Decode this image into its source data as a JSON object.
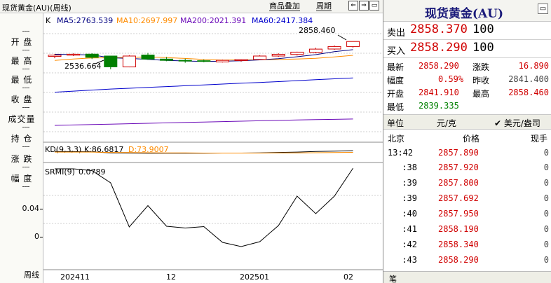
{
  "topbar": {
    "title": "现货黄金(AU)(周线)",
    "overlay_btn": "商品叠加",
    "period_btn": "周期"
  },
  "left_labels": [
    "开 盘",
    "最 高",
    "最 低",
    "收 盘",
    "成交量",
    "持 仓",
    "涨 跌",
    "幅 度"
  ],
  "left_axis": {
    "ticks": [
      "0.04",
      "0"
    ],
    "period_caption": "周线"
  },
  "indicators": {
    "k_prefix": "K",
    "ma": [
      {
        "label": "MA5:2763.539",
        "color": "#000080"
      },
      {
        "label": "MA10:2697.997",
        "color": "#ff8c00"
      },
      {
        "label": "MA200:2021.391",
        "color": "#6b0ab8"
      },
      {
        "label": "MA60:2417.384",
        "color": "#0000cc"
      }
    ],
    "kd": {
      "name": "KD(9,3,3)",
      "k": "K:86.6817",
      "d": "D:73.9007"
    },
    "srmi": {
      "name": "SRMI(9)",
      "value": "0.0789"
    }
  },
  "annotations": {
    "high": "2858.460",
    "low": "2536.664"
  },
  "x_axis_labels": [
    "202411",
    "12",
    "202501",
    "02"
  ],
  "colors": {
    "up": "#d00000",
    "down": "#008000",
    "ma5": "#000080",
    "ma10": "#ff8c00",
    "ma60": "#0000cc",
    "ma200": "#6b0ab8"
  },
  "quote": {
    "title": "现货黄金(AU)",
    "sell_label": "卖出",
    "sell_price": "2858.370",
    "sell_vol": "100",
    "buy_label": "买入",
    "buy_price": "2858.290",
    "buy_vol": "100",
    "stats": [
      {
        "label": "最新",
        "value": "2858.290",
        "color": "#d00000"
      },
      {
        "label": "涨跌",
        "value": "16.890",
        "color": "#d00000"
      },
      {
        "label": "幅度",
        "value": "0.59%",
        "color": "#d00000"
      },
      {
        "label": "昨收",
        "value": "2841.400",
        "color": "#000000"
      },
      {
        "label": "开盘",
        "value": "2841.910",
        "color": "#d00000"
      },
      {
        "label": "最高",
        "value": "2858.460",
        "color": "#d00000"
      },
      {
        "label": "最低",
        "value": "2839.335",
        "color": "#008000"
      }
    ],
    "unit_label": "单位",
    "unit_value": "元/克",
    "checkbox_label": "美元/盎司",
    "checkbox_checked": true,
    "tick_headers": [
      "北京",
      "价格",
      "现手"
    ],
    "ticks": [
      {
        "time": "13:42",
        "price": "2857.890",
        "vol": "0"
      },
      {
        "time": ":38",
        "price": "2857.920",
        "vol": "0"
      },
      {
        "time": ":39",
        "price": "2857.800",
        "vol": "0"
      },
      {
        "time": ":39",
        "price": "2857.692",
        "vol": "0"
      },
      {
        "time": ":40",
        "price": "2857.950",
        "vol": "0"
      },
      {
        "time": ":41",
        "price": "2858.190",
        "vol": "0"
      },
      {
        "time": ":42",
        "price": "2858.340",
        "vol": "0"
      },
      {
        "time": ":43",
        "price": "2858.290",
        "vol": "0"
      }
    ],
    "bottom_tab": "笔"
  },
  "chart_data": [
    {
      "type": "candlestick",
      "title": "",
      "x_labels": [
        "202411",
        "12",
        "202501",
        "02"
      ],
      "candles": [
        {
          "open": 2685,
          "high": 2712,
          "low": 2665,
          "close": 2700,
          "dir": "up"
        },
        {
          "open": 2700,
          "high": 2721,
          "low": 2690,
          "close": 2711,
          "dir": "up"
        },
        {
          "open": 2712,
          "high": 2722,
          "low": 2655,
          "close": 2675,
          "dir": "down"
        },
        {
          "open": 2690,
          "high": 2670,
          "low": 2536.664,
          "close": 2565,
          "dir": "down"
        },
        {
          "open": 2564,
          "high": 2700,
          "low": 2560,
          "close": 2690,
          "dir": "up"
        },
        {
          "open": 2702,
          "high": 2725,
          "low": 2645,
          "close": 2655,
          "dir": "down"
        },
        {
          "open": 2655,
          "high": 2680,
          "low": 2630,
          "close": 2640,
          "dir": "down"
        },
        {
          "open": 2640,
          "high": 2660,
          "low": 2612,
          "close": 2636,
          "dir": "down"
        },
        {
          "open": 2636,
          "high": 2650,
          "low": 2618,
          "close": 2628,
          "dir": "down"
        },
        {
          "open": 2622,
          "high": 2648,
          "low": 2615,
          "close": 2640,
          "dir": "up"
        },
        {
          "open": 2638,
          "high": 2654,
          "low": 2625,
          "close": 2650,
          "dir": "up"
        },
        {
          "open": 2650,
          "high": 2700,
          "low": 2642,
          "close": 2690,
          "dir": "up"
        },
        {
          "open": 2690,
          "high": 2722,
          "low": 2680,
          "close": 2710,
          "dir": "up"
        },
        {
          "open": 2708,
          "high": 2740,
          "low": 2696,
          "close": 2735,
          "dir": "up"
        },
        {
          "open": 2733,
          "high": 2786,
          "low": 2722,
          "close": 2770,
          "dir": "up"
        },
        {
          "open": 2771,
          "high": 2812,
          "low": 2760,
          "close": 2800,
          "dir": "up"
        },
        {
          "open": 2800,
          "high": 2858.46,
          "low": 2785,
          "close": 2858.29,
          "dir": "up"
        }
      ],
      "ma5": [
        2710,
        2707,
        2703,
        2670,
        2662,
        2652,
        2640,
        2632,
        2628,
        2630,
        2636,
        2645,
        2660,
        2682,
        2706,
        2740,
        2763.539
      ],
      "ma10": [
        2640,
        2656,
        2668,
        2670,
        2676,
        2680,
        2672,
        2662,
        2650,
        2644,
        2645,
        2646,
        2650,
        2655,
        2664,
        2680,
        2697.997
      ],
      "ma60": [
        2280,
        2290,
        2300,
        2310,
        2318,
        2326,
        2334,
        2342,
        2350,
        2358,
        2366,
        2374,
        2382,
        2391,
        2400,
        2409,
        2417.384
      ],
      "ma200": [
        1960,
        1964,
        1968,
        1972,
        1976,
        1980,
        1984,
        1988,
        1992,
        1996,
        2000,
        2004,
        2008,
        2012,
        2015,
        2018,
        2021.391
      ],
      "ylim": [
        1950,
        2880
      ]
    },
    {
      "type": "line",
      "name": "KD(9,3,3)",
      "series": [
        {
          "name": "K",
          "values": [
            80,
            79,
            78,
            70,
            68,
            67,
            67,
            67,
            67,
            68,
            68,
            70,
            73,
            76,
            80,
            83,
            86.6817
          ]
        },
        {
          "name": "D",
          "values": [
            76,
            76,
            76,
            73,
            72,
            71,
            70,
            69,
            68,
            68,
            68,
            68,
            69,
            70,
            71,
            72,
            73.9007
          ]
        }
      ],
      "ylim": [
        0,
        120
      ]
    },
    {
      "type": "line",
      "name": "SRMI(9)",
      "series": [
        {
          "name": "SRMI",
          "values": [
            0.078,
            0.078,
            0.0755,
            0.058,
            -0.005,
            0.0255,
            -0.004,
            -0.0065,
            -0.0045,
            -0.027,
            -0.033,
            -0.026,
            -0.003,
            0.039,
            0.014,
            0.039,
            0.0789
          ]
        }
      ],
      "ylim": [
        -0.036,
        0.085
      ]
    }
  ]
}
